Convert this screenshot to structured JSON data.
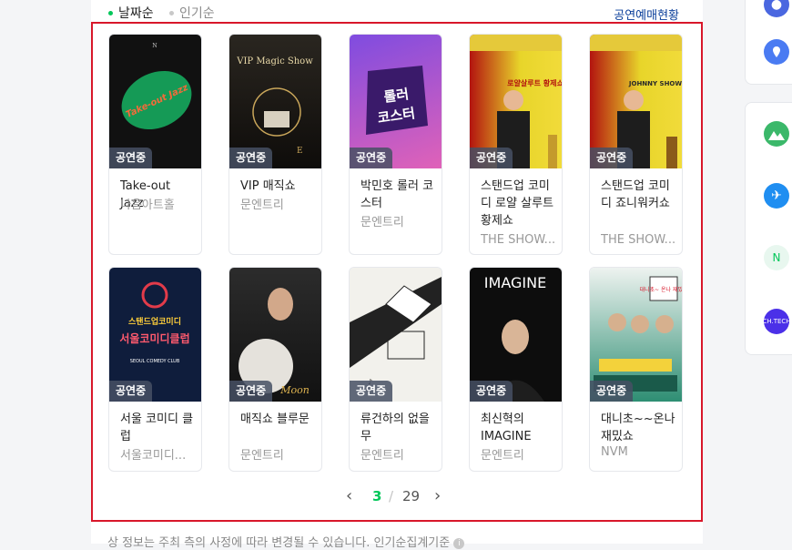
{
  "sort": {
    "latest": "날짜순",
    "popular": "인기순"
  },
  "status_link": "공연예매현황",
  "badge": "공연중",
  "cards": [
    {
      "title": "Take-out Jazz",
      "venue": "나음아트홀",
      "poster_text": "Take-out Jazz"
    },
    {
      "title": "VIP 매직쇼",
      "venue": "문엔트리",
      "poster_text": "VIP Magic Show"
    },
    {
      "title": "박민호 롤러 코스터",
      "venue": "문엔트리",
      "poster_text": "롤러 코스터"
    },
    {
      "title": "스탠드업 코미디 로얄 살루트 황제쇼",
      "venue": "THE SHOW...",
      "poster_text": "로얄살루트 황제쇼"
    },
    {
      "title": "스탠드업 코미디 죠니워커쇼",
      "venue": "THE SHOW...",
      "poster_text": "JOHNNY SHOW"
    },
    {
      "title": "서울 코미디 클럽",
      "venue": "서울코미디...",
      "poster_text": "스탠드업코미디 서울코미디클럽"
    },
    {
      "title": "매직쇼 블루문",
      "venue": "문엔트리",
      "poster_text": "Moon"
    },
    {
      "title": "류건하의 없을무",
      "venue": "문엔트리",
      "poster_text": ""
    },
    {
      "title": "최신혁의 IMAGINE",
      "venue": "문엔트리",
      "poster_text": "IMAGINE"
    },
    {
      "title": "대니초~~온나 재밌쇼",
      "venue": "NVM",
      "poster_text": "대니초~ 온나 재밌쇼"
    }
  ],
  "pagination": {
    "current": "3",
    "separator": "/",
    "total": "29",
    "prev": "‹",
    "next": "›"
  },
  "footnote": "상 정보는 주최 측의 사정에 따라 변경될 수 있습니다. 인기순집계기준",
  "side": {
    "tech_label": "CH.TECH"
  },
  "colors": {
    "accent": "#03c75a",
    "highlight": "#d8172a",
    "link": "#0a3e9a"
  }
}
